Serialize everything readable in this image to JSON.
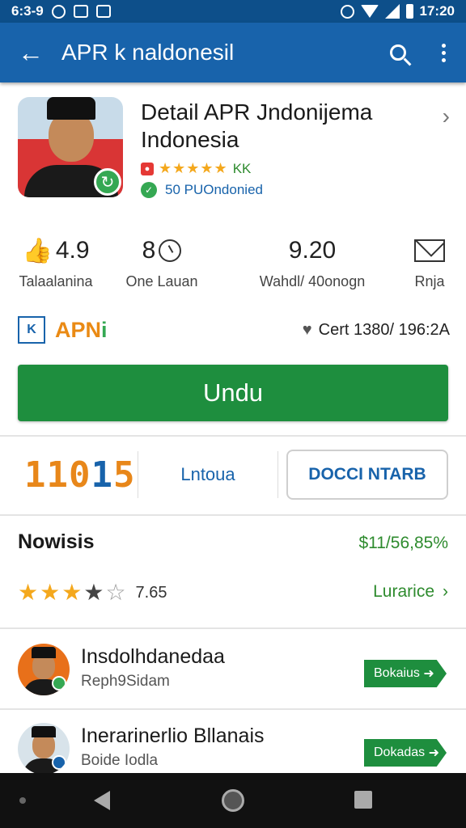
{
  "status_bar": {
    "time_left": "6:3-9",
    "time_right": "17:20"
  },
  "app_bar": {
    "title": "APR k naldonesil"
  },
  "app": {
    "name_line1": "Detail APR Jndonijema",
    "name_line2": "Indonesia",
    "rating_code": "KK",
    "installs": "50 PUOndonied",
    "stars_filled": 5
  },
  "stats": [
    {
      "value": "4.9",
      "label": "Talaalanina",
      "icon": "thumbs-up-icon"
    },
    {
      "value": "8",
      "label": "One Lauan",
      "icon": "clock-icon"
    },
    {
      "value": "9.20",
      "label": "Wahdl/ 40onogn",
      "icon": ""
    },
    {
      "value": "",
      "label": "Rnja",
      "icon": "mail-icon"
    }
  ],
  "brand": {
    "logo_text": "K",
    "name_a": "APN",
    "name_b": "i",
    "cert_text": "Cert 1380/ 196:2A"
  },
  "install_button": {
    "label": "Undu"
  },
  "developer": {
    "logo_a": "110",
    "logo_b": "1",
    "logo_c": "5",
    "tab_label": "Lntoua",
    "button_label": "DOCCI NTARB"
  },
  "reviews": {
    "title": "Nowisis",
    "percent": "$11/56,85%",
    "score": "7.65",
    "rating": 3.5,
    "link_label": "Lurarice"
  },
  "list": [
    {
      "title": "Insdolhdanedaa",
      "subtitle": "Reph9Sidam",
      "button": "Bokaius",
      "badge_color": "#35a853"
    },
    {
      "title": "Inerarinerlio Bllanais",
      "subtitle": "Boide Iodla",
      "button": "Dokadas",
      "badge_color": "#1863ab"
    }
  ],
  "colors": {
    "app_bar": "#1863ab",
    "status_bar": "#0d4f8a",
    "accent_green": "#1e8e3e",
    "star": "#f4a81d"
  }
}
